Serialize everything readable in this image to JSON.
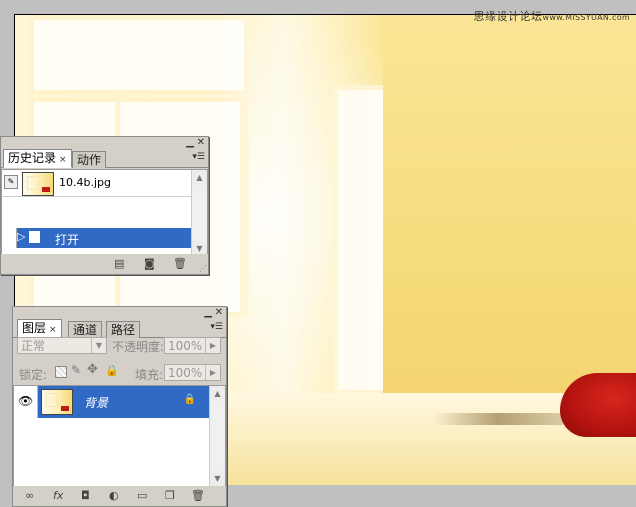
{
  "watermark": {
    "main": "思缘设计论坛",
    "url": "www.MISSYUAN.com"
  },
  "history_panel": {
    "tabs": [
      {
        "label": "历史记录",
        "close": "×"
      },
      {
        "label": "动作"
      }
    ],
    "snapshot_name": "10.4b.jpg",
    "items": [
      {
        "label": "打开"
      }
    ]
  },
  "layers_panel": {
    "tabs": [
      {
        "label": "图层",
        "close": "×"
      },
      {
        "label": "通道"
      },
      {
        "label": "路径"
      }
    ],
    "blend_mode": "正常",
    "opacity_label": "不透明度:",
    "opacity_value": "100%",
    "lock_label": "锁定:",
    "fill_label": "填充:",
    "fill_value": "100%",
    "layers": [
      {
        "name": "背景"
      }
    ],
    "footer_fx": "fx"
  },
  "icons": {
    "panel_menu": "menu-arrow-icon",
    "minimize": "minimize-icon",
    "close": "close-icon",
    "eye": "eye-icon",
    "lock": "lock-icon"
  }
}
